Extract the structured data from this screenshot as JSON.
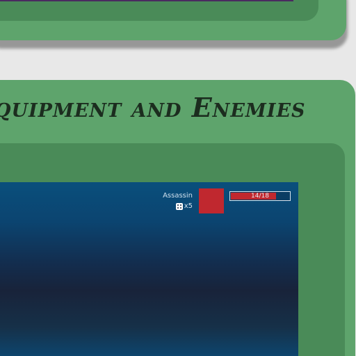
{
  "section": {
    "title": "Equipment and Enemies"
  },
  "enemy": {
    "name": "Assassin",
    "dice_label": "x5",
    "dice_icon": "dice-icon",
    "hp_text": "14/18",
    "hp_current": 14,
    "hp_max": 18,
    "portrait_color": "#c0282f"
  },
  "colors": {
    "card_green": "#5ea46c",
    "card_inner_green": "#4a8b58",
    "title_ink": "#1c2d1f",
    "hp_red": "#c0282f",
    "top_strip_purple": "#4a2a60"
  }
}
